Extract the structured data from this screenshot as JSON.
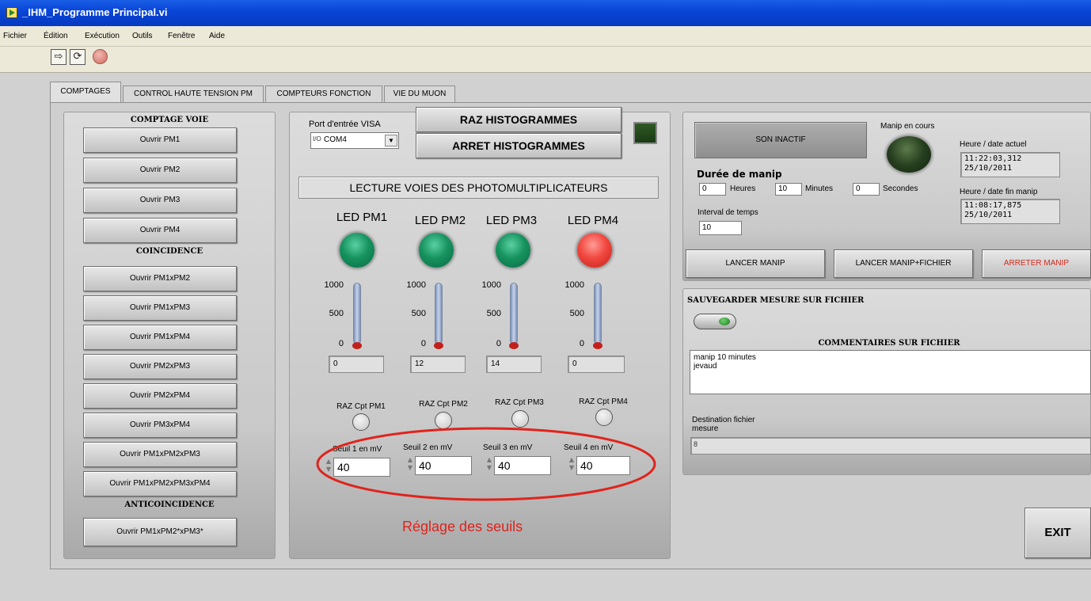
{
  "window": {
    "title": "_IHM_Programme Principal.vi"
  },
  "menu": [
    "Fichier",
    "Édition",
    "Exécution",
    "Outils",
    "Fenêtre",
    "Aide"
  ],
  "toolbar": {
    "run_icon": "run-arrow-icon",
    "run_continuous_icon": "run-continuously-icon",
    "abort_icon": "abort-icon"
  },
  "tabs": [
    {
      "label": "COMPTAGES",
      "active": true
    },
    {
      "label": "CONTROL HAUTE TENSION PM",
      "active": false
    },
    {
      "label": "COMPTEURS FONCTION",
      "active": false
    },
    {
      "label": "VIE DU MUON",
      "active": false
    }
  ],
  "comptage": {
    "voie_title": "COMPTAGE VOIE",
    "voie_buttons": [
      "Ouvrir PM1",
      "Ouvrir PM2",
      "Ouvrir PM3",
      "Ouvrir PM4"
    ],
    "coincidence_title": "COINCIDENCE",
    "coincidence_buttons": [
      "Ouvrir PM1xPM2",
      "Ouvrir PM1xPM3",
      "Ouvrir PM1xPM4",
      "Ouvrir PM2xPM3",
      "Ouvrir PM2xPM4",
      "Ouvrir PM3xPM4",
      "Ouvrir PM1xPM2xPM3",
      "Ouvrir PM1xPM2xPM3xPM4"
    ],
    "anticoincidence_title": "ANTICOINCIDENCE",
    "anticoincidence_buttons": [
      "Ouvrir PM1xPM2*xPM3*"
    ]
  },
  "visa": {
    "label": "Port d'entrée VISA",
    "prefix": "I/O",
    "value": "COM4"
  },
  "histogram_buttons": {
    "raz": "RAZ HISTOGRAMMES",
    "stop": "ARRET HISTOGRAMMES"
  },
  "lecture_title": "LECTURE VOIES DES PHOTOMULTIPLICATEURS",
  "pms": [
    {
      "led_label": "LED PM1",
      "led_color": "#16935f",
      "scale": [
        "1000",
        "500",
        "0"
      ],
      "count": "0",
      "raz_label": "RAZ Cpt PM1",
      "seuil_label": "Seuil 1 en mV",
      "seuil_value": "40"
    },
    {
      "led_label": "LED PM2",
      "led_color": "#16935f",
      "scale": [
        "1000",
        "500",
        "0"
      ],
      "count": "12",
      "raz_label": "RAZ Cpt PM2",
      "seuil_label": "Seuil 2 en mV",
      "seuil_value": "40"
    },
    {
      "led_label": "LED PM3",
      "led_color": "#16935f",
      "scale": [
        "1000",
        "500",
        "0"
      ],
      "count": "14",
      "raz_label": "RAZ Cpt PM3",
      "seuil_label": "Seuil 3 en mV",
      "seuil_value": "40"
    },
    {
      "led_label": "LED PM4",
      "led_color": "#f1483f",
      "scale": [
        "1000",
        "500",
        "0"
      ],
      "count": "0",
      "raz_label": "RAZ Cpt PM4",
      "seuil_label": "Seuil 4 en mV",
      "seuil_value": "40"
    }
  ],
  "annotation": {
    "text": "Réglage des seuils",
    "color": "#e0231c"
  },
  "manip": {
    "son_button": "SON INACTIF",
    "en_cours_label": "Manip en cours",
    "duree_title": "Durée de manip",
    "heures_value": "0",
    "heures_label": "Heures",
    "minutes_value": "10",
    "minutes_label": "Minutes",
    "secondes_value": "0",
    "secondes_label": "Secondes",
    "interval_label": "Interval de temps",
    "interval_value": "10",
    "heure_actuel_label": "Heure / date actuel",
    "heure_actuel_time": "11:22:03,312",
    "heure_actuel_date": "25/10/2011",
    "heure_fin_label": "Heure / date fin manip",
    "heure_fin_time": "11:08:17,875",
    "heure_fin_date": "25/10/2011",
    "lancer": "LANCER MANIP",
    "lancer_fichier": "LANCER MANIP+FICHIER",
    "arreter": "ARRETER MANIP",
    "arreter_color": "#d42a1e"
  },
  "save": {
    "title": "SAUVEGARDER MESURE SUR FICHIER",
    "comments_title": "COMMENTAIRES SUR FICHIER",
    "comment_line1": "manip 10 minutes",
    "comment_line2": "jevaud",
    "dest_label_1": "Destination fichier",
    "dest_label_2": "mesure",
    "path_icon": "path-icon"
  },
  "exit_label": "EXIT"
}
